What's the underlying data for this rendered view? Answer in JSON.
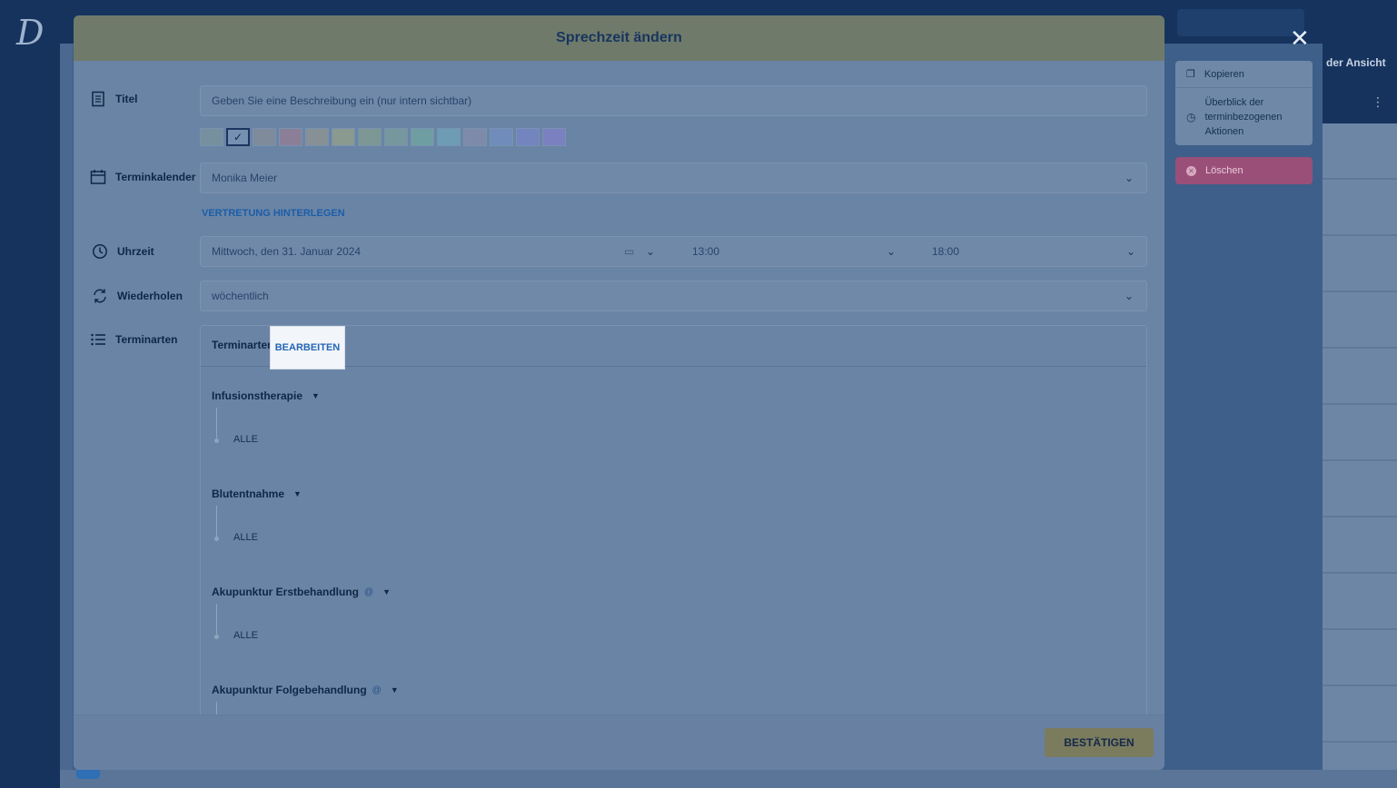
{
  "modal": {
    "title": "Sprechzeit ändern",
    "fields": {
      "title_label": "Titel",
      "title_placeholder": "Geben Sie eine Beschreibung ein (nur intern sichtbar)",
      "calendar_label": "Terminkalender",
      "calendar_value": "Monika Meier",
      "substitute_link": "VERTRETUNG HINTERLEGEN",
      "time_label": "Uhrzeit",
      "date_value": "Mittwoch, den 31. Januar 2024",
      "start_time": "13:00",
      "end_time": "18:00",
      "repeat_label": "Wiederholen",
      "repeat_value": "wöchentlich",
      "types_label": "Terminarten"
    },
    "colors": [
      "#77909f",
      "#7590b0",
      "#7f8a9a",
      "#8a7f97",
      "#879094",
      "#8a9a8f",
      "#7d9894",
      "#77979e",
      "#6f9ea2",
      "#6e9cb4",
      "#7e8aa9",
      "#6f8cbb",
      "#7384be",
      "#7a80c0"
    ],
    "selected_color_index": 1,
    "terminarten": {
      "header": "Terminarten",
      "edit_button": "BEARBEITEN",
      "items": [
        {
          "name": "Infusionstherapie",
          "sub": "ALLE",
          "online": false
        },
        {
          "name": "Blutentnahme",
          "sub": "ALLE",
          "online": false
        },
        {
          "name": "Akupunktur Erstbehandlung",
          "sub": "ALLE",
          "online": true
        },
        {
          "name": "Akupunktur Folgebehandlung",
          "sub": "",
          "online": true
        }
      ],
      "online_symbol": "@"
    },
    "confirm_button": "BESTÄTIGEN"
  },
  "side_actions": {
    "copy": "Kopieren",
    "overview": "Überblick der terminbezogenen Aktionen",
    "delete": "Löschen"
  },
  "background": {
    "right_label": "der Ansicht",
    "logo": "D"
  }
}
